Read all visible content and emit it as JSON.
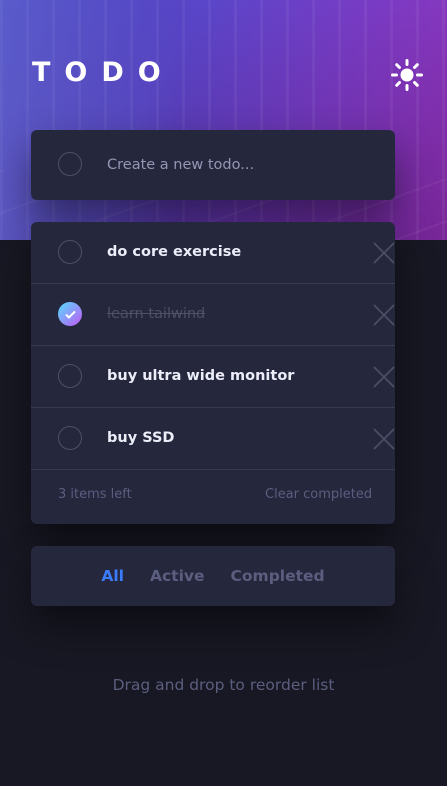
{
  "app": {
    "title": "TODO",
    "theme_icon": "sun-icon"
  },
  "new_todo": {
    "placeholder": "Create a new todo..."
  },
  "todos": [
    {
      "text": "do core exercise",
      "completed": false
    },
    {
      "text": "learn tailwind",
      "completed": true
    },
    {
      "text": "buy ultra wide monitor",
      "completed": false
    },
    {
      "text": "buy SSD",
      "completed": false
    }
  ],
  "footer": {
    "items_left": "3 items left",
    "clear_label": "Clear completed"
  },
  "filters": [
    {
      "label": "All",
      "active": true
    },
    {
      "label": "Active",
      "active": false
    },
    {
      "label": "Completed",
      "active": false
    }
  ],
  "hint": "Drag and drop to reorder list",
  "colors": {
    "background": "#171823",
    "card": "#25273d",
    "accent": "#3a7cfd",
    "check_gradient_start": "#55ddff",
    "check_gradient_end": "#c058f3"
  }
}
